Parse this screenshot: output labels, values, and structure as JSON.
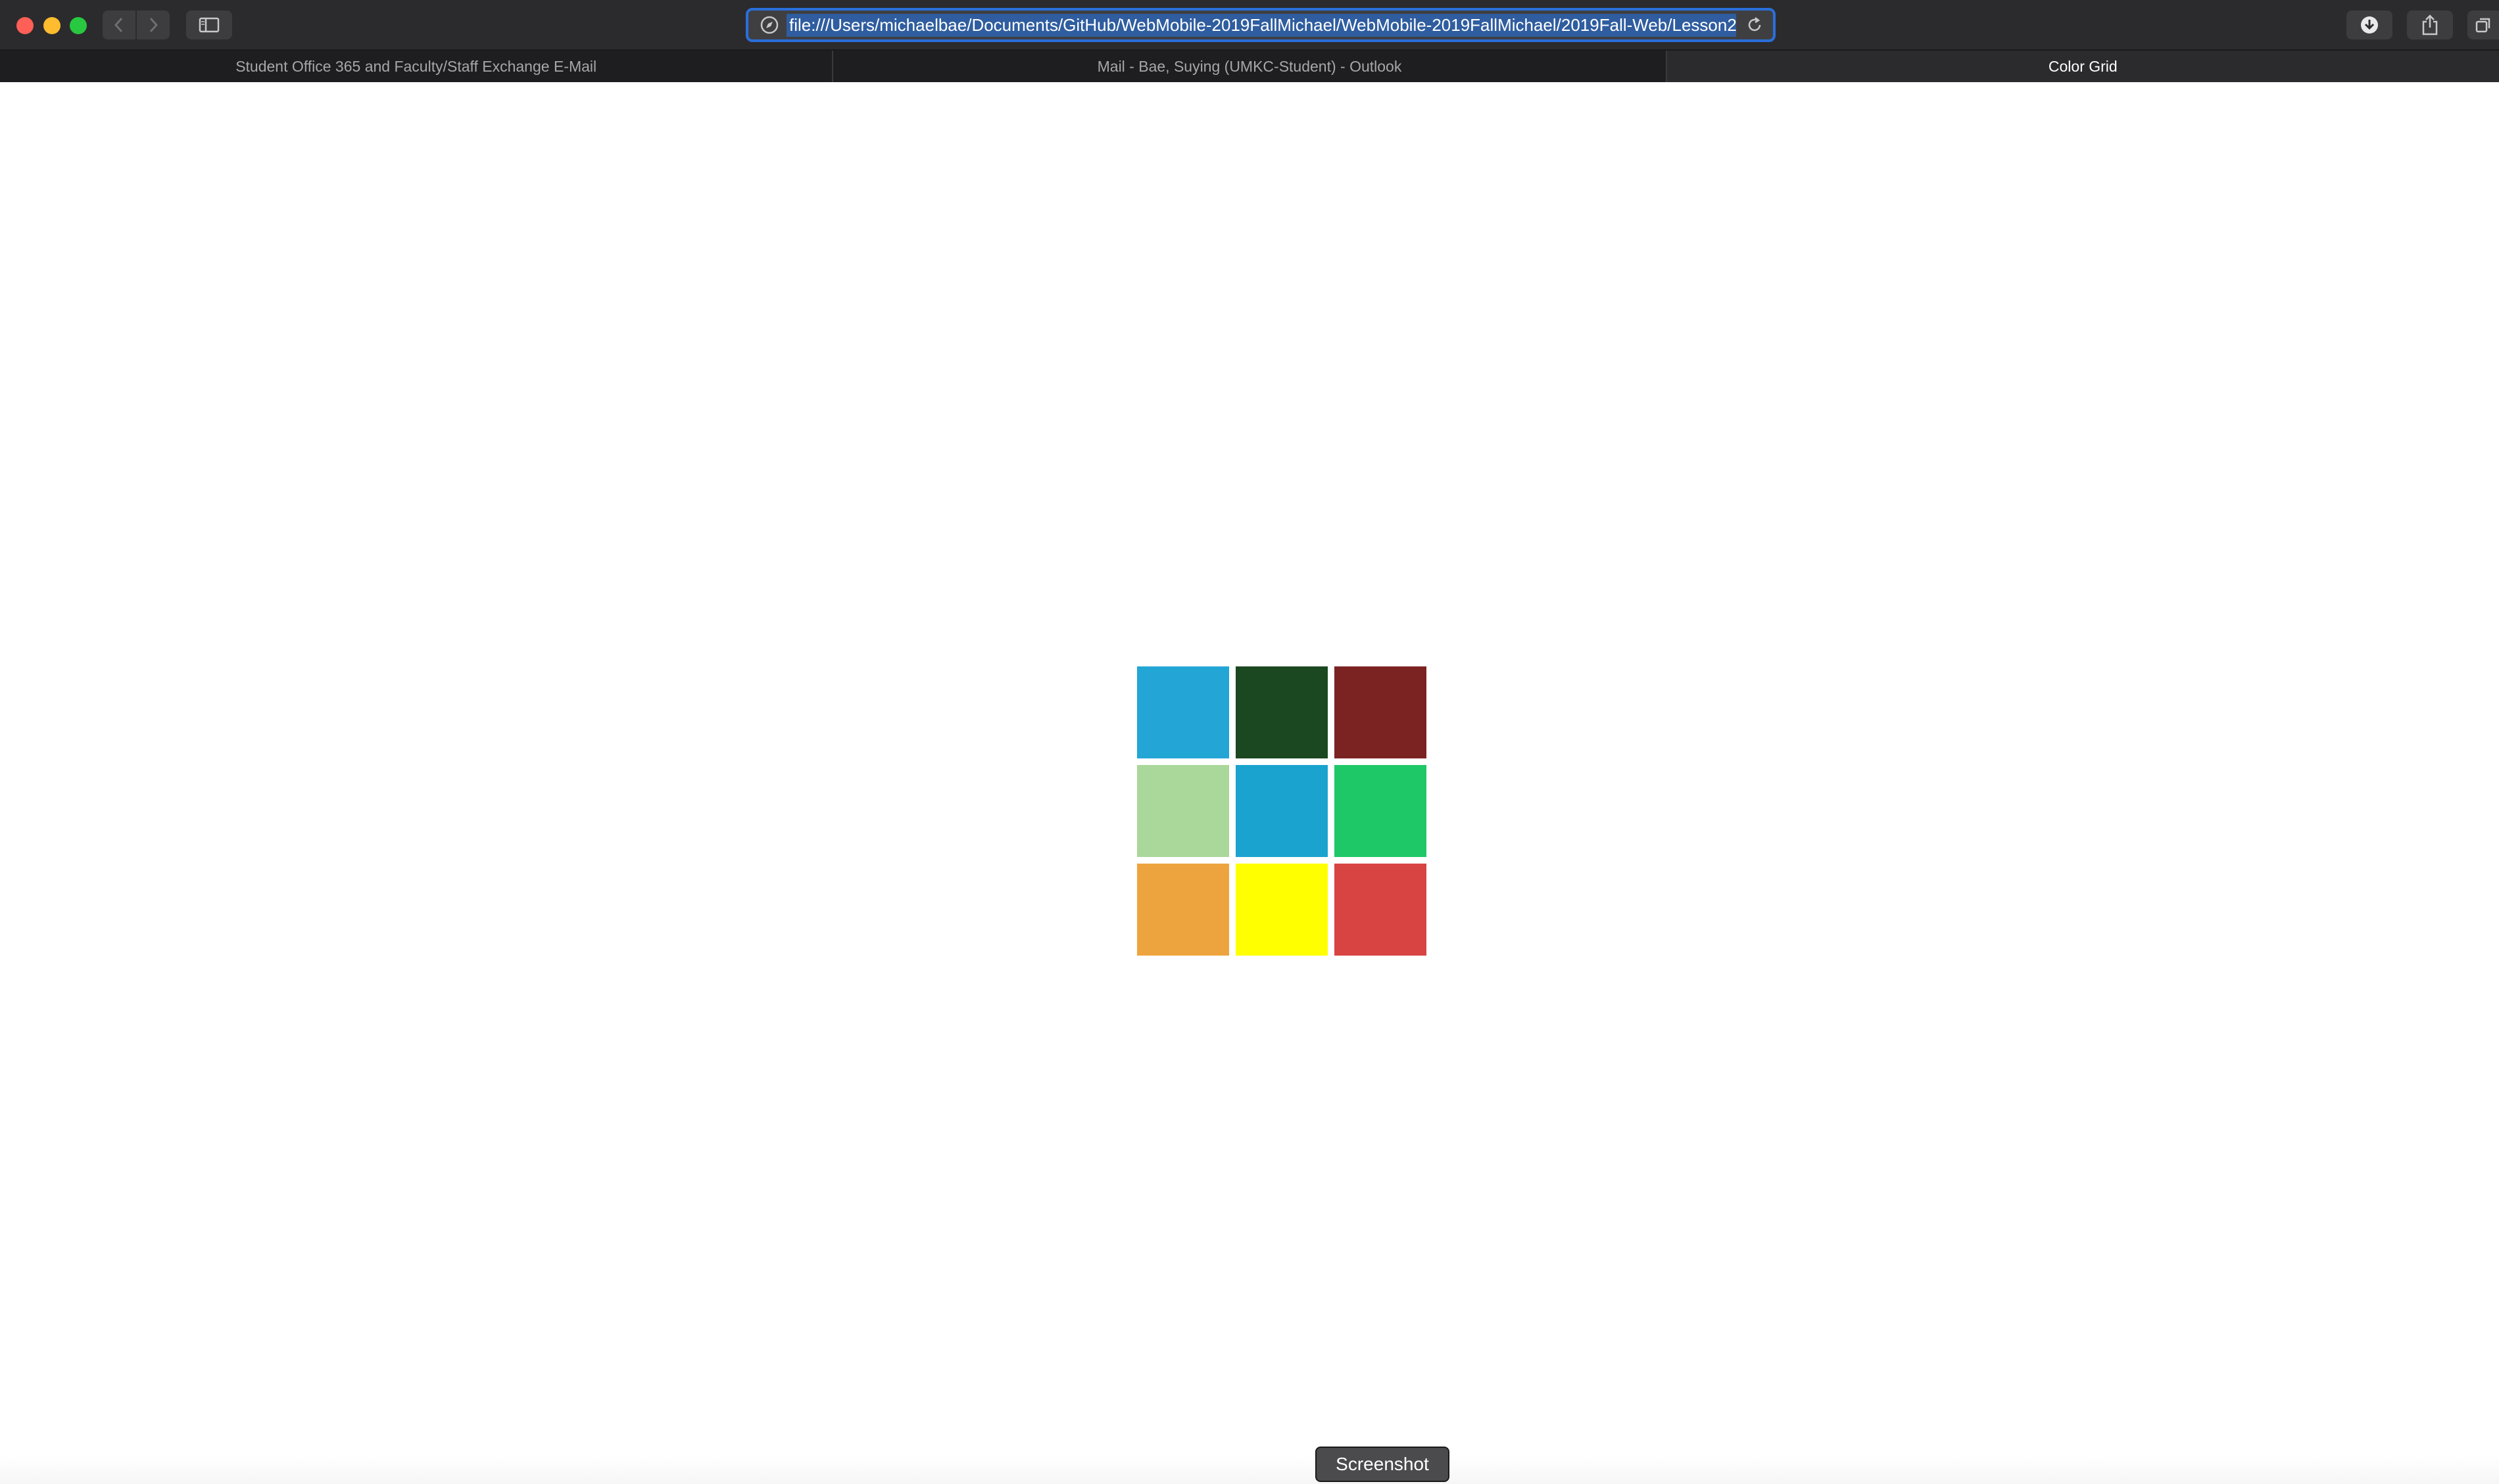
{
  "browser": {
    "url": "file:///Users/michaelbae/Documents/GitHub/WebMobile-2019FallMichael/WebMobile-2019FallMichael/2019Fall-Web/Lesson2/So",
    "tabs": [
      {
        "label": "Student Office 365 and Faculty/Staff Exchange E-Mail",
        "active": false
      },
      {
        "label": "Mail - Bae, Suying (UMKC-Student) - Outlook",
        "active": false
      },
      {
        "label": "Color Grid",
        "active": true
      }
    ],
    "icons": {
      "back": "chevron-left-icon",
      "forward": "chevron-right-icon",
      "sidebar": "sidebar-icon",
      "compass": "compass-icon",
      "reload": "reload-icon",
      "download": "download-icon",
      "share": "share-icon",
      "tabs": "tab-overview-icon"
    }
  },
  "page": {
    "grid_colors": [
      "#23a6d5",
      "#1b4820",
      "#7b2322",
      "#aad79a",
      "#1aa3cf",
      "#1ec866",
      "#eea43e",
      "#ffff00",
      "#d84442"
    ]
  },
  "overlay": {
    "tooltip": "Screenshot"
  }
}
